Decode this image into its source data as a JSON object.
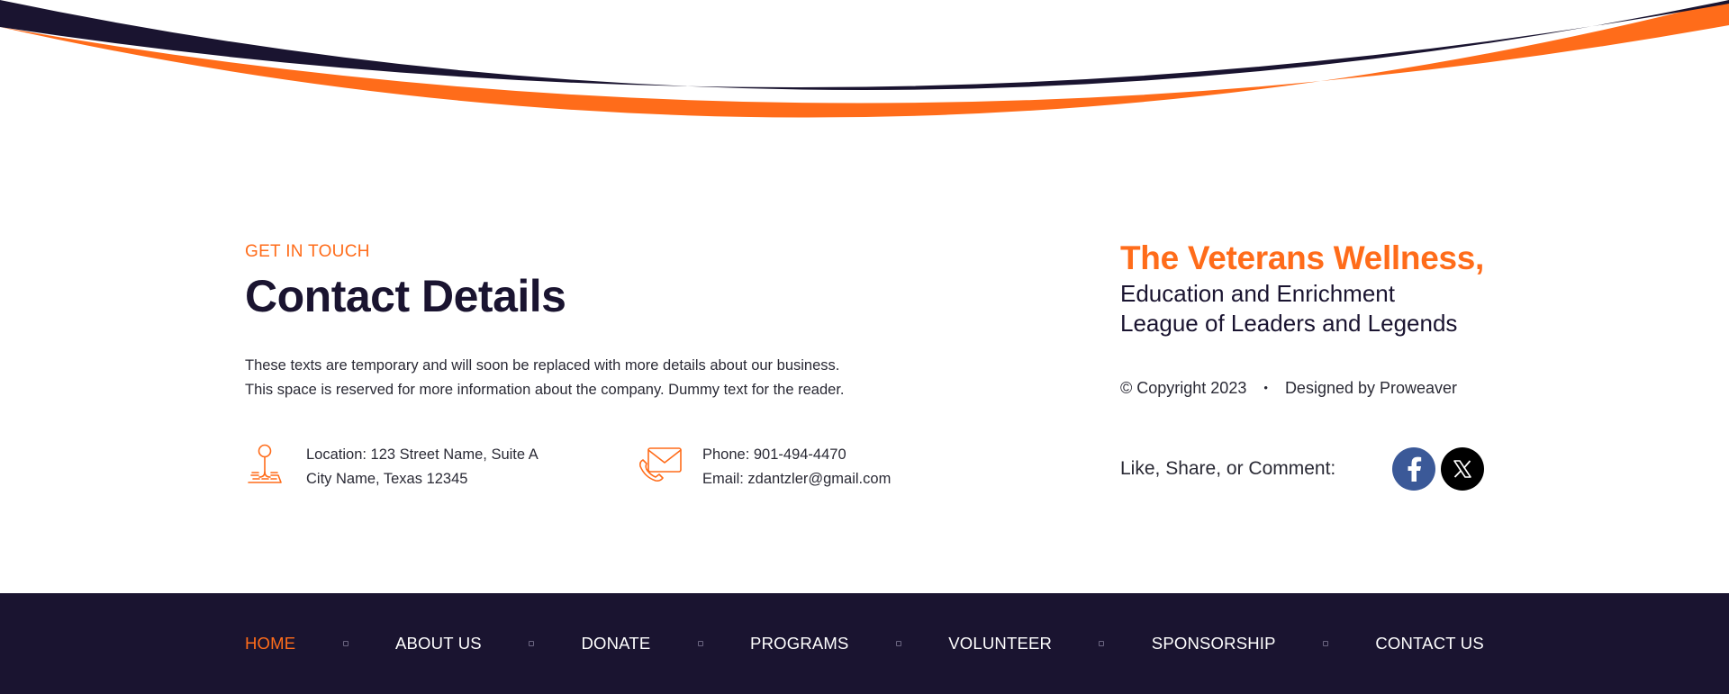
{
  "contact": {
    "eyebrow": "GET IN TOUCH",
    "title": "Contact Details",
    "intro_line1": "These texts are temporary and will soon be replaced with more details about our business.",
    "intro_line2": "This space is reserved for more information about the company. Dummy text for the reader.",
    "location_line1": "Location: 123 Street Name, Suite A",
    "location_line2": "City Name, Texas 12345",
    "phone_line": "Phone: 901-494-4470",
    "email_line": "Email: zdantzler@gmail.com",
    "icons": [
      "map-pin-icon",
      "envelope-phone-icon"
    ]
  },
  "org": {
    "name": "The Veterans Wellness,",
    "tagline_line1": "Education and Enrichment",
    "tagline_line2": "League of Leaders and Legends",
    "copyright": "© Copyright 2023",
    "separator": "•",
    "designed_by": "Designed by Proweaver",
    "social_label": "Like, Share, or Comment:",
    "social": [
      {
        "name": "facebook-icon",
        "glyph": "f"
      },
      {
        "name": "x-icon",
        "glyph": "𝕏"
      }
    ]
  },
  "footer": {
    "nav": [
      "HOME",
      "ABOUT US",
      "DONATE",
      "PROGRAMS",
      "VOLUNTEER",
      "SPONSORSHIP",
      "CONTACT US"
    ],
    "active": "HOME"
  },
  "colors": {
    "accent": "#ff6c1a",
    "navy": "#1a1430",
    "facebook": "#3b5998",
    "x": "#000000"
  }
}
